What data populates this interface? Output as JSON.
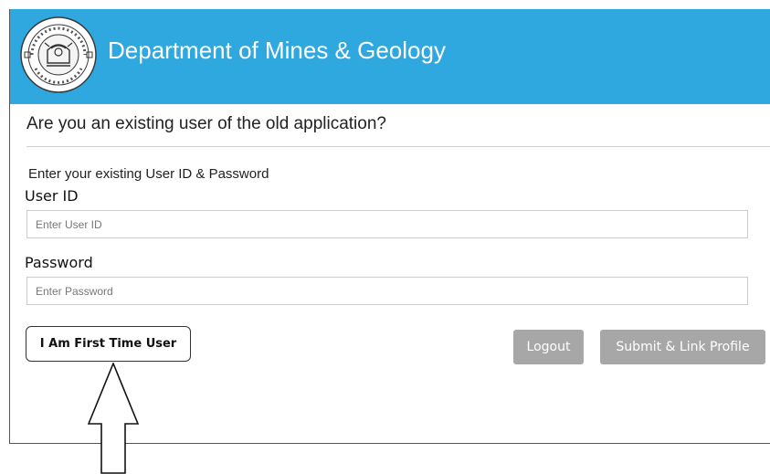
{
  "header": {
    "title": "Department of Mines & Geology",
    "emblem_icon": "rajasthan-emblem-icon",
    "background_color": "#2ea8de"
  },
  "form": {
    "question": "Are you an existing user of the old application?",
    "instruction": "Enter your existing User ID & Password",
    "user_id": {
      "label": "User ID",
      "placeholder": "Enter User ID",
      "value": ""
    },
    "password": {
      "label": "Password",
      "placeholder": "Enter Password",
      "value": ""
    }
  },
  "buttons": {
    "first_time_user": "I Am First Time User",
    "logout": "Logout",
    "submit_link": "Submit & Link Profile",
    "disabled_color": "#a7a7a7"
  },
  "annotation": {
    "arrow_icon": "up-arrow-icon"
  }
}
